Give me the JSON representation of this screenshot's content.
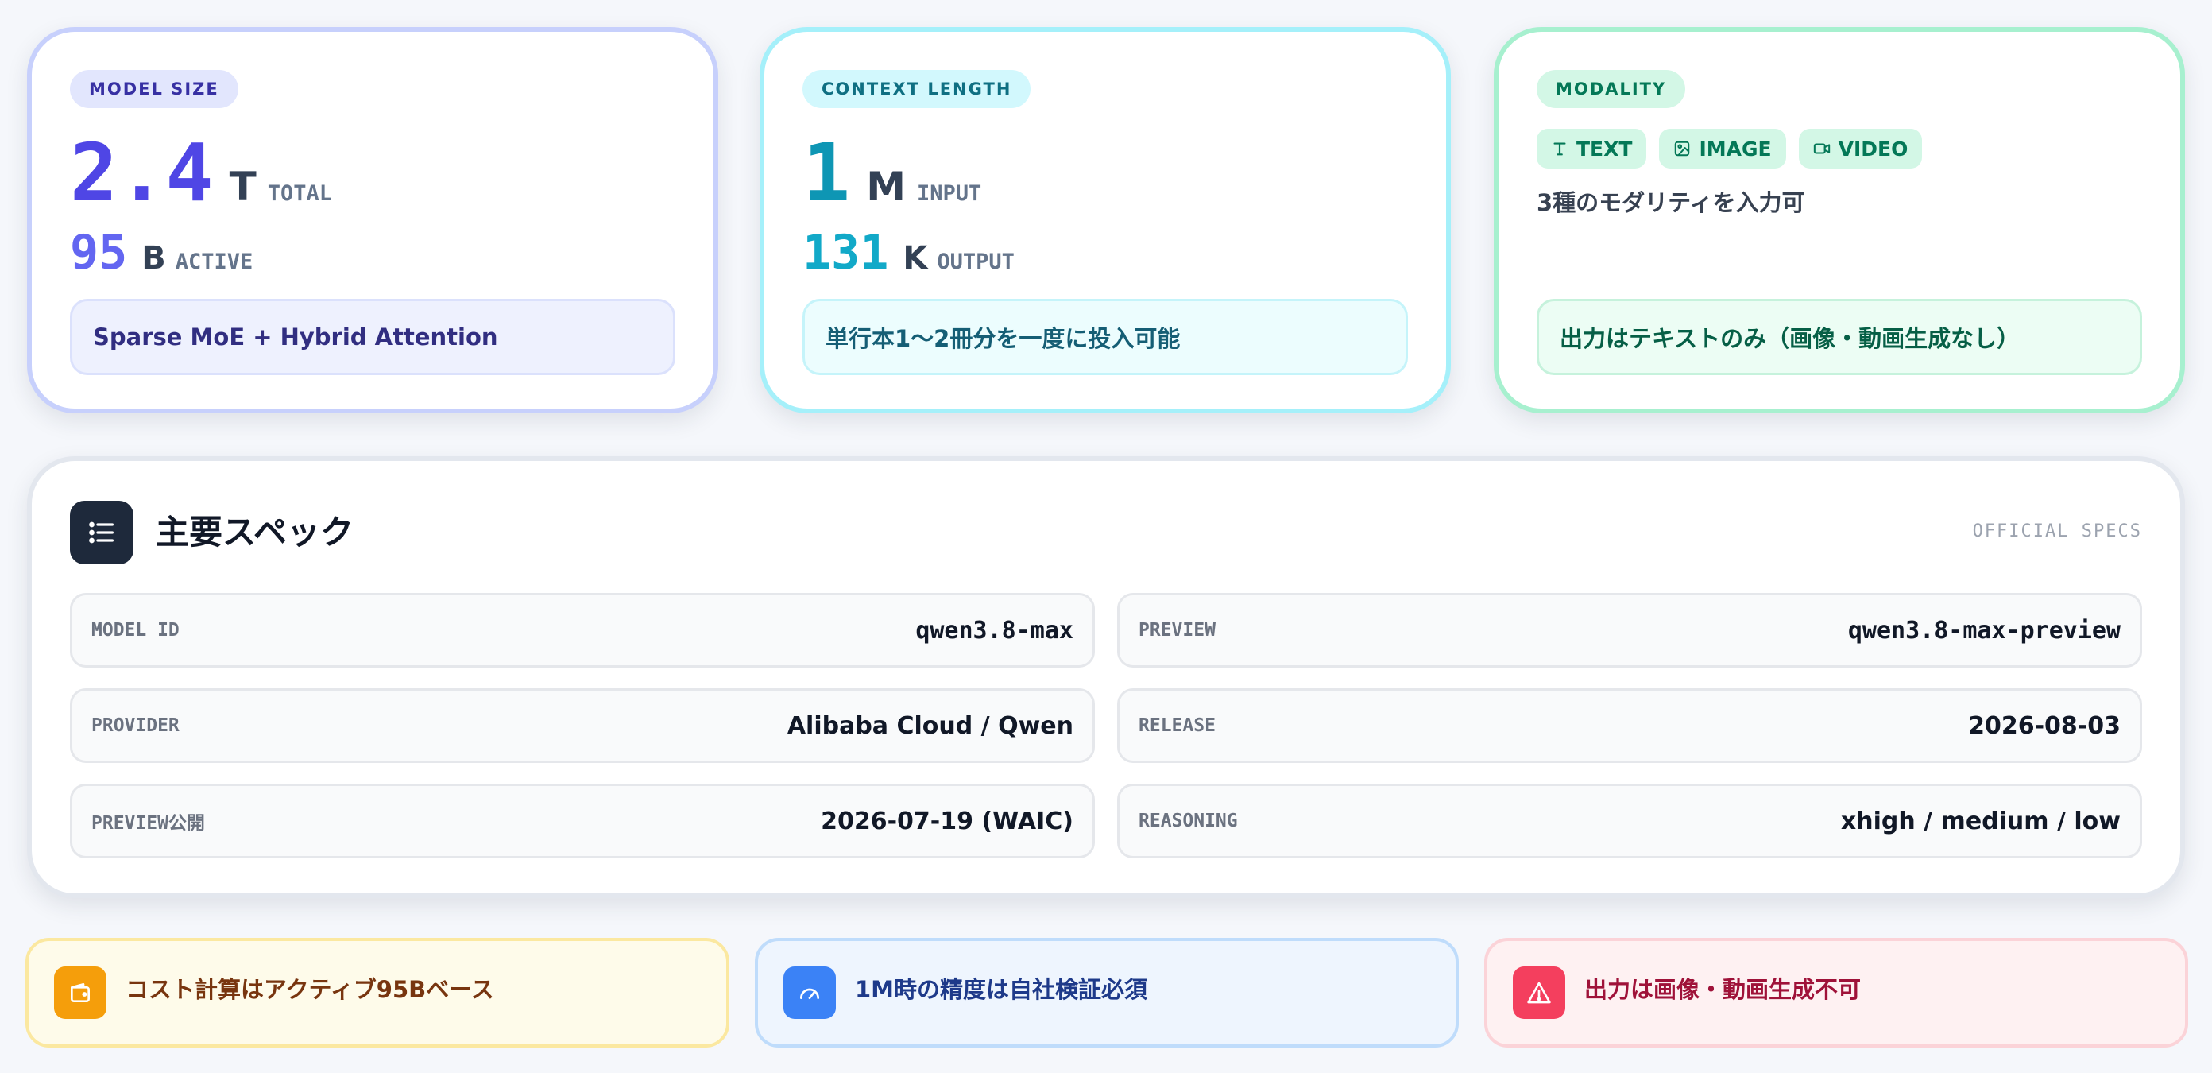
{
  "model_size": {
    "badge": "MODEL SIZE",
    "total": {
      "value": "2.4",
      "unit": "T",
      "label": "TOTAL"
    },
    "active": {
      "value": "95",
      "unit": "B",
      "label": "ACTIVE"
    },
    "note": "Sparse MoE + Hybrid Attention"
  },
  "context_length": {
    "badge": "CONTEXT LENGTH",
    "input": {
      "value": "1",
      "unit": "M",
      "label": "INPUT"
    },
    "output": {
      "value": "131",
      "unit": "K",
      "label": "OUTPUT"
    },
    "note": "単行本1〜2冊分を一度に投入可能"
  },
  "modality": {
    "badge": "MODALITY",
    "chips": [
      {
        "label": "TEXT",
        "icon": "text-icon"
      },
      {
        "label": "IMAGE",
        "icon": "image-icon"
      },
      {
        "label": "VIDEO",
        "icon": "video-icon"
      }
    ],
    "description": "3種のモダリティを入力可",
    "note": "出力はテキストのみ（画像・動画生成なし）"
  },
  "specs": {
    "icon": "list-icon",
    "title": "主要スペック",
    "tag": "OFFICIAL SPECS",
    "rows": [
      {
        "key": "MODEL ID",
        "value": "qwen3.8-max"
      },
      {
        "key": "PREVIEW",
        "value": "qwen3.8-max-preview"
      },
      {
        "key": "PROVIDER",
        "value": "Alibaba Cloud / Qwen"
      },
      {
        "key": "RELEASE",
        "value": "2026-08-03"
      },
      {
        "key": "PREVIEW公開",
        "value": "2026-07-19 (WAIC)"
      },
      {
        "key": "REASONING",
        "value": "xhigh / medium / low"
      }
    ]
  },
  "notices": [
    {
      "icon": "wallet-icon",
      "text": "コスト計算はアクティブ95Bベース",
      "color": "#f59e0b"
    },
    {
      "icon": "gauge-icon",
      "text": "1M時の精度は自社検証必須",
      "color": "#3b82f6"
    },
    {
      "icon": "warning-icon",
      "text": "出力は画像・動画生成不可",
      "color": "#f43f5e"
    }
  ],
  "colors": {
    "indigo": "#4f46e5",
    "cyan": "#0e96b4",
    "green": "#047857",
    "dark": "#1e293b"
  }
}
